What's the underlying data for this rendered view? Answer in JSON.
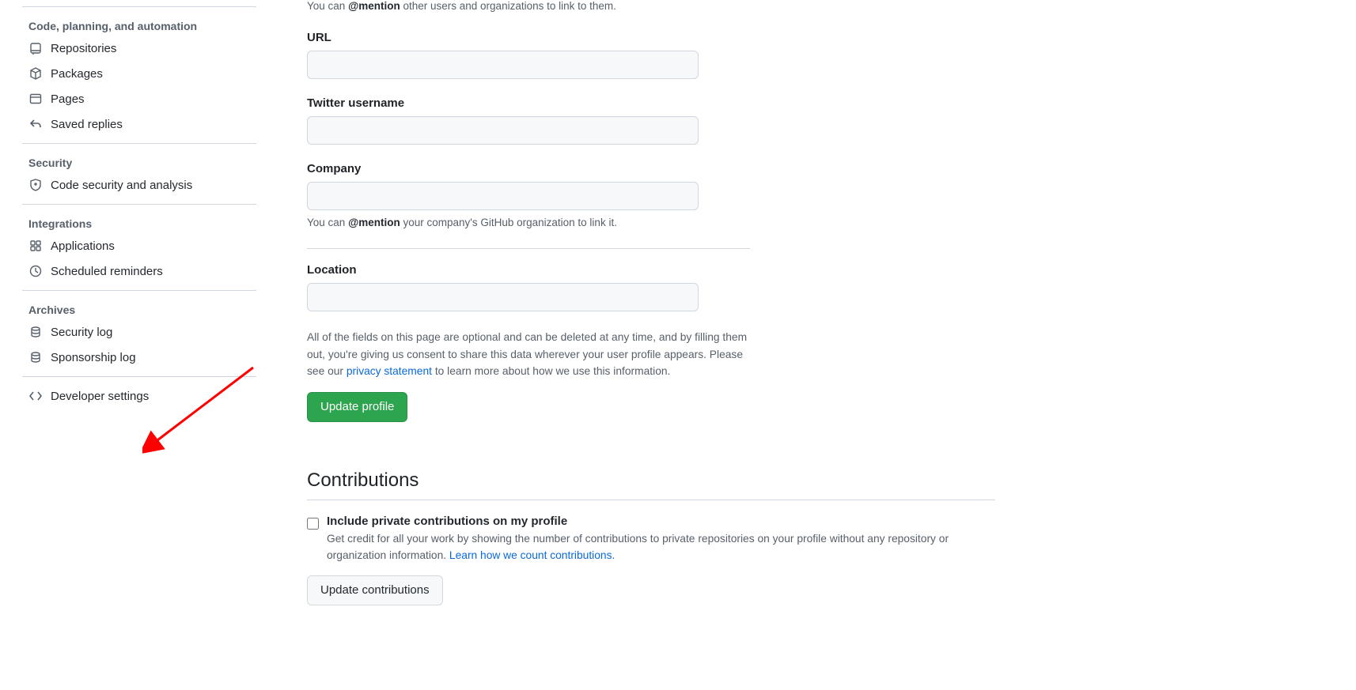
{
  "sidebar": {
    "groups": [
      {
        "heading": "Code, planning, and automation",
        "items": [
          {
            "icon": "repo-icon",
            "label": "Repositories"
          },
          {
            "icon": "package-icon",
            "label": "Packages"
          },
          {
            "icon": "browser-icon",
            "label": "Pages"
          },
          {
            "icon": "reply-icon",
            "label": "Saved replies"
          }
        ]
      },
      {
        "heading": "Security",
        "items": [
          {
            "icon": "shield-icon",
            "label": "Code security and analysis"
          }
        ]
      },
      {
        "heading": "Integrations",
        "items": [
          {
            "icon": "apps-icon",
            "label": "Applications"
          },
          {
            "icon": "clock-icon",
            "label": "Scheduled reminders"
          }
        ]
      },
      {
        "heading": "Archives",
        "items": [
          {
            "icon": "log-icon",
            "label": "Security log"
          },
          {
            "icon": "log-icon",
            "label": "Sponsorship log"
          }
        ]
      }
    ],
    "footer_item": {
      "icon": "code-icon",
      "label": "Developer settings"
    }
  },
  "profile": {
    "bio_note_prefix": "You can ",
    "bio_note_mention": "@mention",
    "bio_note_suffix": " other users and organizations to link to them.",
    "url_label": "URL",
    "twitter_label": "Twitter username",
    "company_label": "Company",
    "company_hint_prefix": "You can ",
    "company_hint_mention": "@mention",
    "company_hint_suffix": " your company's GitHub organization to link it.",
    "location_label": "Location",
    "disclosure_prefix": "All of the fields on this page are optional and can be deleted at any time, and by filling them out, you're giving us consent to share this data wherever your user profile appears. Please see our ",
    "disclosure_link": "privacy statement",
    "disclosure_suffix": " to learn more about how we use this information.",
    "update_button": "Update profile"
  },
  "contributions": {
    "heading": "Contributions",
    "checkbox_label": "Include private contributions on my profile",
    "desc_prefix": "Get credit for all your work by showing the number of contributions to private repositories on your profile without any repository or organization information. ",
    "desc_link": "Learn how we count contributions.",
    "update_button": "Update contributions"
  }
}
